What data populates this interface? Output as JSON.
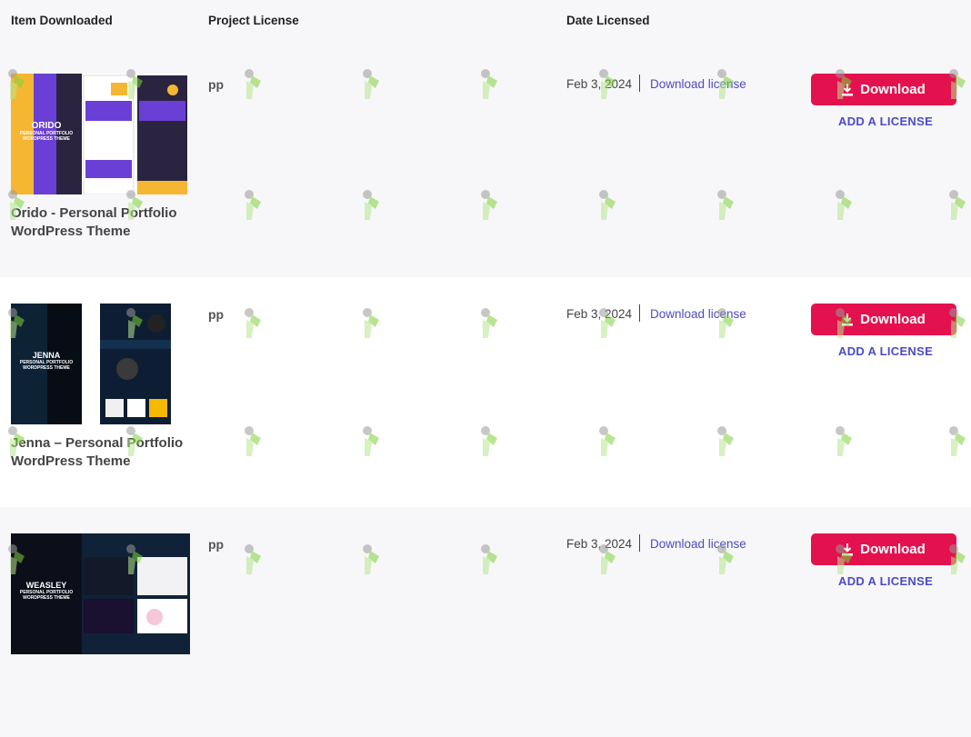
{
  "header": {
    "item_downloaded": "Item Downloaded",
    "project_license": "Project License",
    "date_licensed": "Date Licensed"
  },
  "rows": [
    {
      "title": "Orido - Personal Portfolio WordPress Theme",
      "thumb_text": [
        "ORIDO",
        "PERSONAL PORTFOLIO",
        "WORDPRESS THEME"
      ],
      "license": "pp",
      "date": "Feb 3, 2024",
      "download_license": "Download license",
      "download_label": "Download",
      "add_license": "ADD A LICENSE"
    },
    {
      "title": "Jenna – Personal Portfolio WordPress Theme",
      "thumb_text": [
        "JENNA",
        "PERSONAL PORTFOLIO",
        "WORDPRESS THEME"
      ],
      "license": "pp",
      "date": "Feb 3, 2024",
      "download_license": "Download license",
      "download_label": "Download",
      "add_license": "ADD A LICENSE"
    },
    {
      "title": "",
      "thumb_text": [
        "WEASLEY",
        "PERSONAL PORTFOLIO",
        "WORDPRESS THEME"
      ],
      "license": "pp",
      "date": "Feb 3, 2024",
      "download_license": "Download license",
      "download_label": "Download",
      "add_license": "ADD A LICENSE"
    }
  ],
  "colors": {
    "accent_red": "#e3124e",
    "link_purple": "#4b4bc5"
  }
}
